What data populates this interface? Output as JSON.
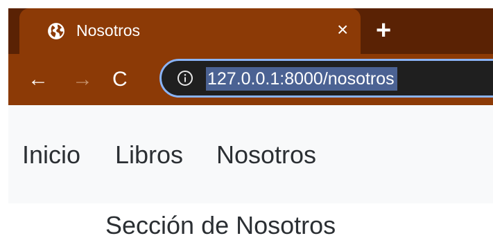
{
  "browser": {
    "tab": {
      "title": "Nosotros",
      "favicon": "globe-icon",
      "close_label": "×"
    },
    "new_tab_label": "+",
    "toolbar": {
      "back_label": "←",
      "forward_label": "→",
      "reload_label": "C",
      "info_icon": "info-icon",
      "url": "127.0.0.1:8000/nosotros"
    },
    "colors": {
      "tabstrip": "#5a2204",
      "active_tab": "#8c3a06",
      "omnibox": "#1f1f1f",
      "omnibox_border": "#8ab4f8",
      "url_selection": "#4b6293"
    }
  },
  "page": {
    "navbar": {
      "links": [
        {
          "label": "Inicio"
        },
        {
          "label": "Libros"
        },
        {
          "label": "Nosotros"
        }
      ]
    },
    "heading": "Sección de Nosotros",
    "colors": {
      "navbar_background": "#f8f9fa",
      "text": "#2b2f33"
    }
  }
}
